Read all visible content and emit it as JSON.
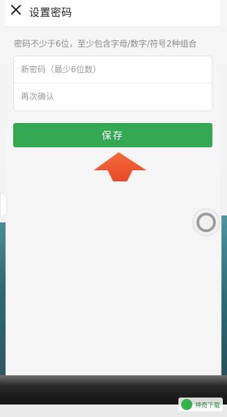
{
  "header": {
    "title": "设置密码",
    "close_icon": "close-icon"
  },
  "form": {
    "hint": "密码不少于6位，至少包含字母/数字/符号2种组合",
    "new_password_placeholder": "新密码（最少6位数）",
    "confirm_placeholder": "再次确认"
  },
  "actions": {
    "save_label": "保存"
  },
  "overlays": {
    "annotation_arrow": "arrow-up-icon",
    "floating_button": "assistive-touch-icon"
  },
  "watermark": {
    "text": "神奇下载"
  },
  "colors": {
    "accent": "#35a853",
    "arrow": "#f0552f"
  }
}
